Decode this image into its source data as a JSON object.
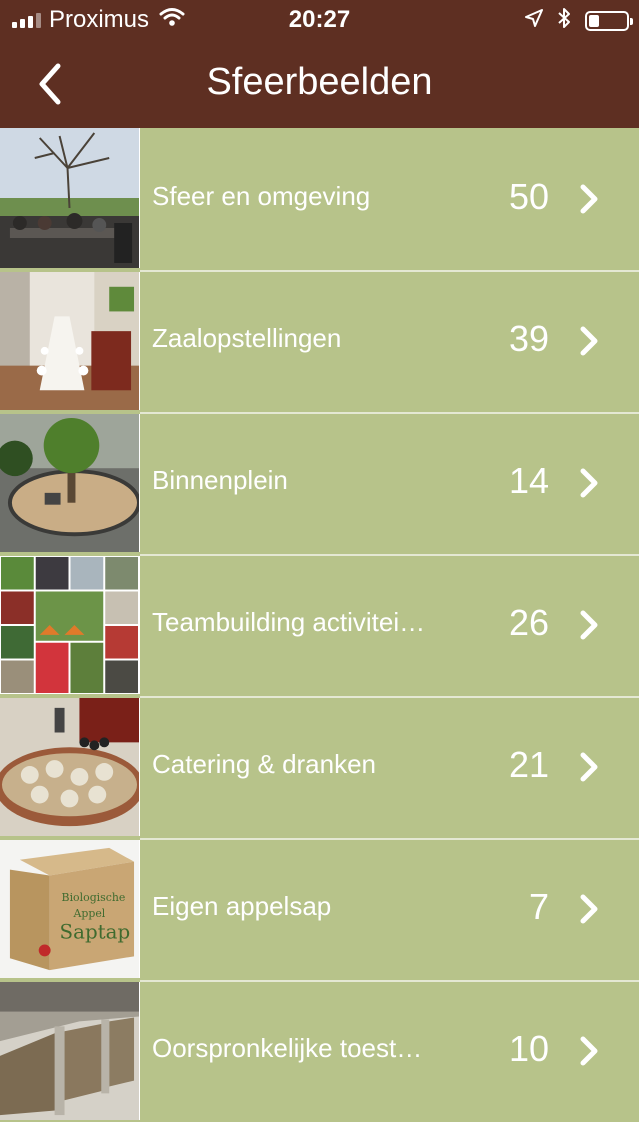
{
  "status_bar": {
    "carrier": "Proximus",
    "time": "20:27",
    "icons": [
      "signal-icon",
      "wifi-icon",
      "location-icon",
      "bluetooth-icon",
      "battery-icon"
    ],
    "battery_level": 0.25
  },
  "nav": {
    "title": "Sfeerbeelden",
    "back_icon": "chevron-left-icon"
  },
  "colors": {
    "header_bg": "#5e2f22",
    "row_bg": "#b7c38a",
    "text": "#ffffff"
  },
  "items": [
    {
      "label": "Sfeer en omgeving",
      "count": "50",
      "thumb": "terrace-photo"
    },
    {
      "label": "Zaalopstellingen",
      "count": "39",
      "thumb": "meeting-room-photo"
    },
    {
      "label": "Binnenplein",
      "count": "14",
      "thumb": "courtyard-photo"
    },
    {
      "label": "Teambuilding activitei…",
      "count": "26",
      "thumb": "activities-collage-photo"
    },
    {
      "label": "Catering & dranken",
      "count": "21",
      "thumb": "catering-photo"
    },
    {
      "label": "Eigen appelsap",
      "count": "7",
      "thumb": "apple-juice-box-photo"
    },
    {
      "label": "Oorspronkelijke toest…",
      "count": "10",
      "thumb": "stable-interior-photo"
    }
  ],
  "thumb_texts": {
    "juice_box": [
      "Biologische",
      "Appel",
      "Saptap"
    ]
  }
}
